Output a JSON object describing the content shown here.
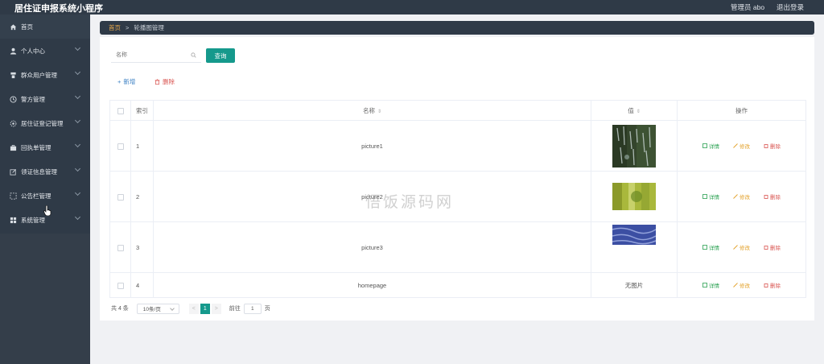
{
  "app": {
    "title": "居住证申报系统小程序",
    "admin": "管理员 abo",
    "logout": "退出登录"
  },
  "sidebar": {
    "items": [
      {
        "label": "首页",
        "icon": "home-icon"
      },
      {
        "label": "个人中心",
        "icon": "user-icon"
      },
      {
        "label": "群众用户管理",
        "icon": "people-icon"
      },
      {
        "label": "警方管理",
        "icon": "clock-icon"
      },
      {
        "label": "居住证登记管理",
        "icon": "settings-icon"
      },
      {
        "label": "回执单管理",
        "icon": "briefcase-icon"
      },
      {
        "label": "领证信息管理",
        "icon": "edit-icon"
      },
      {
        "label": "公告栏管理",
        "icon": "dashed-square-icon"
      },
      {
        "label": "系统管理",
        "icon": "grid-icon"
      }
    ]
  },
  "breadcrumb": {
    "home": "首页",
    "separator": ">",
    "current": "轮播图管理"
  },
  "search": {
    "placeholder": "名称",
    "value": "",
    "button": "查询"
  },
  "actions": {
    "add": "新增",
    "delete": "删除"
  },
  "table": {
    "headers": {
      "index": "索引",
      "name": "名称",
      "value": "值",
      "ops": "操作"
    },
    "rows": [
      {
        "index": "1",
        "name": "picture1",
        "value": "",
        "image": "waterfall-dark-green"
      },
      {
        "index": "2",
        "name": "picture2",
        "value": "",
        "image": "yellow-green-forest"
      },
      {
        "index": "3",
        "name": "picture3",
        "value": "",
        "image": "blue-water"
      },
      {
        "index": "4",
        "name": "homepage",
        "value": "无图片",
        "image": ""
      }
    ],
    "ops": {
      "detail": "详情",
      "edit": "修改",
      "delete": "删除"
    }
  },
  "pagination": {
    "total": "共 4 条",
    "page_size": "10条/页",
    "current": "1",
    "goto_label": "前往",
    "goto_value": "1",
    "page_unit": "页",
    "prev": "<",
    "next": ">"
  },
  "watermark": "悟饭源码网",
  "colors": {
    "sidebar": "#2f3a47",
    "primary": "#15998c",
    "link": "#3e82c4",
    "danger": "#d9534f",
    "warning": "#e3a22b",
    "success": "#27a04f",
    "breadcrumb_home": "#e8a84a"
  }
}
